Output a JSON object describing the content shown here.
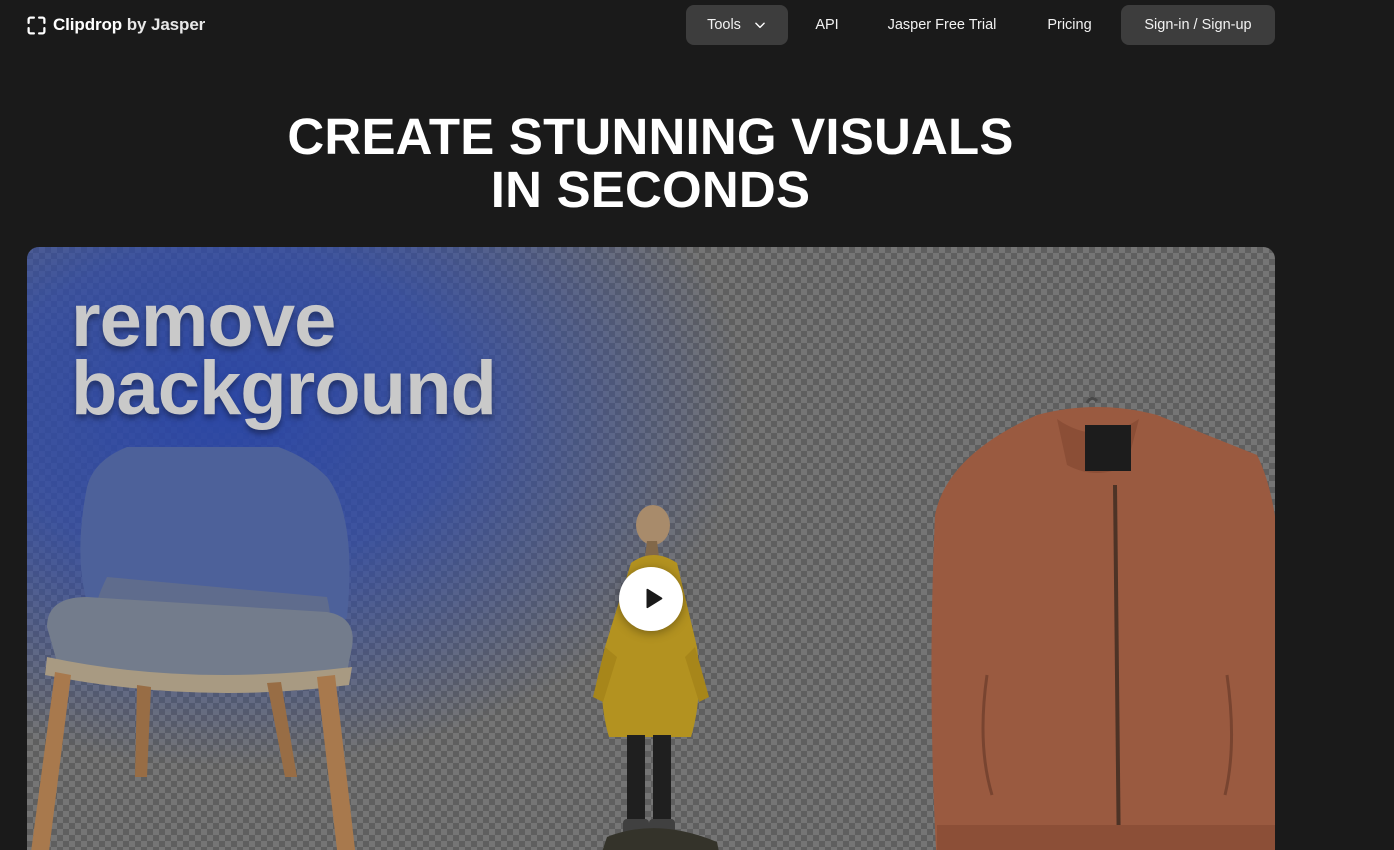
{
  "brand": {
    "name": "Clipdrop",
    "by": "by Jasper",
    "icon": "clipdrop-logo-icon"
  },
  "nav": {
    "tools": "Tools",
    "api": "API",
    "trial": "Jasper Free Trial",
    "pricing": "Pricing",
    "signin": "Sign-in / Sign-up"
  },
  "hero": {
    "title_line1": "CREATE STUNNING VISUALS",
    "title_line2": "IN SECONDS"
  },
  "media": {
    "headline_line1": "remove",
    "headline_line2": "background",
    "play_icon": "play-icon"
  },
  "colors": {
    "background": "#1a1a1a",
    "nav_button": "#3d3d3d",
    "accent_blue": "#2d50c8",
    "text": "#ffffff"
  }
}
